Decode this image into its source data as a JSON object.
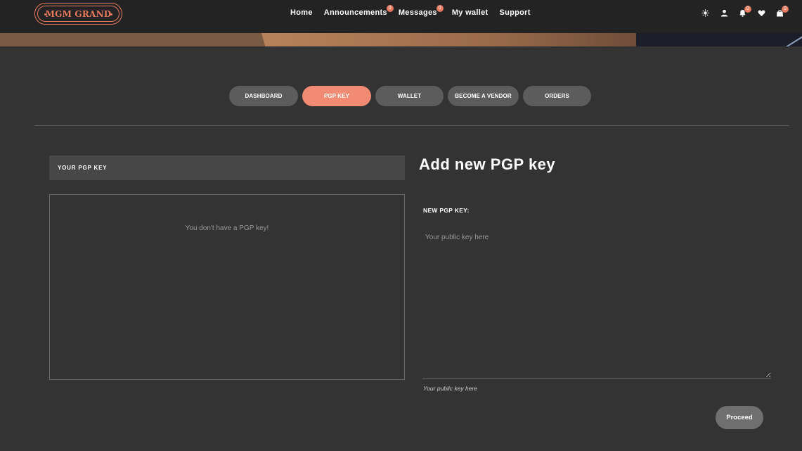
{
  "brand": {
    "logo_text": "MGM GRAND",
    "accent_color": "#e8795f"
  },
  "nav": {
    "items": [
      {
        "label": "Home",
        "badge": null
      },
      {
        "label": "Announcements",
        "badge": "0"
      },
      {
        "label": "Messages",
        "badge": "0"
      },
      {
        "label": "My wallet",
        "badge": null
      },
      {
        "label": "Support",
        "badge": null
      }
    ]
  },
  "header_icons": {
    "theme": {
      "icon": "sun-icon"
    },
    "account": {
      "icon": "user-icon"
    },
    "notifications": {
      "icon": "bell-icon",
      "badge": "0"
    },
    "wishlist": {
      "icon": "heart-icon"
    },
    "cart": {
      "icon": "shopping-bag-icon",
      "badge": "0"
    }
  },
  "tabs": [
    {
      "label": "DASHBOARD",
      "active": false
    },
    {
      "label": "PGP KEY",
      "active": true
    },
    {
      "label": "WALLET",
      "active": false
    },
    {
      "label": "BECOME A VENDOR",
      "active": false
    },
    {
      "label": "ORDERS",
      "active": false
    }
  ],
  "your_key": {
    "header": "YOUR PGP KEY",
    "empty_message": "You don't have a PGP key!"
  },
  "add_key": {
    "title": "Add new PGP key",
    "field_label": "NEW PGP KEY:",
    "placeholder": "Your public key here",
    "value": "",
    "help_text": "Your public key here",
    "submit_label": "Proceed"
  }
}
